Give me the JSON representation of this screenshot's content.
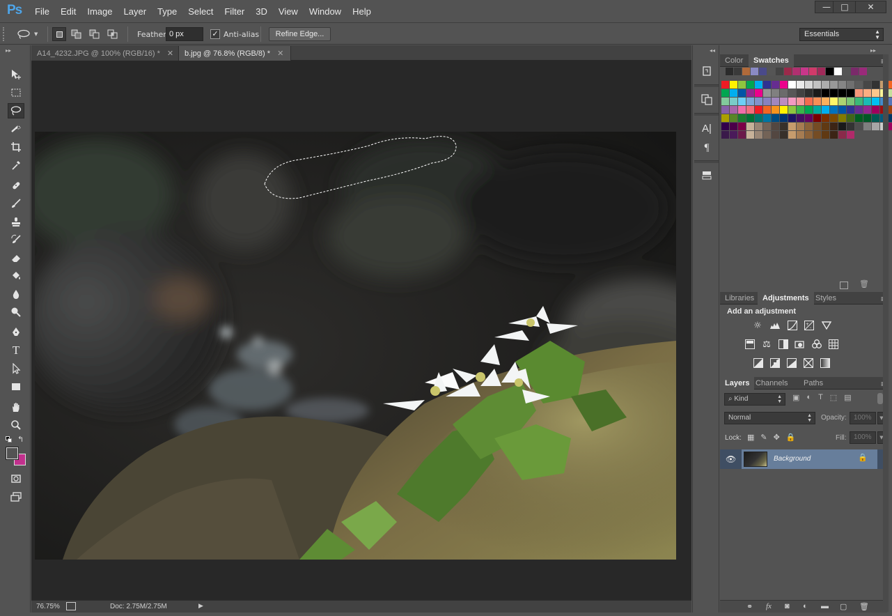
{
  "app": {
    "logo": "Ps"
  },
  "menu": [
    "File",
    "Edit",
    "Image",
    "Layer",
    "Type",
    "Select",
    "Filter",
    "3D",
    "View",
    "Window",
    "Help"
  ],
  "window_controls": {
    "minimize": "—",
    "restore": "□",
    "close": "✕"
  },
  "options_bar": {
    "feather_label": "Feather:",
    "feather_value": "0 px",
    "antialias_label": "Anti-alias",
    "antialias_checked": true,
    "refine_edge_label": "Refine Edge...",
    "workspace": "Essentials"
  },
  "tabs": [
    {
      "label": "A14_4232.JPG @ 100% (RGB/16) *",
      "active": false
    },
    {
      "label": "b.jpg @ 76.8% (RGB/8) *",
      "active": true
    }
  ],
  "status": {
    "zoom": "76.75%",
    "doc": "Doc: 2.75M/2.75M"
  },
  "colors": {
    "foreground": "#535353",
    "background": "#c2308d",
    "accent": "#4ea5e9"
  },
  "panels": {
    "color_group": {
      "tabs": [
        "Color",
        "Swatches"
      ],
      "active": "Swatches"
    },
    "adjust_group": {
      "tabs": [
        "Libraries",
        "Adjustments",
        "Styles"
      ],
      "active": "Adjustments",
      "title": "Add an adjustment"
    },
    "layers_group": {
      "tabs": [
        "Layers",
        "Channels",
        "Paths"
      ],
      "active": "Layers",
      "filter_kind": "Kind",
      "blend_mode": "Normal",
      "opacity_label": "Opacity:",
      "opacity_value": "100%",
      "lock_label": "Lock:",
      "fill_label": "Fill:",
      "fill_value": "100%",
      "layers": [
        {
          "name": "Background",
          "visible": true,
          "locked": true
        }
      ]
    }
  },
  "swatches": [
    [
      "#2b2b2b",
      "#3a3a3a",
      "#b06a3a",
      "#8a8ac4",
      "#4a4a8a",
      "#555",
      "#444",
      "#9a2a4a",
      "#b03070",
      "#c8368a",
      "#d03a6a",
      "#a02a5a",
      "#000",
      "#ffffff",
      "#555",
      "#7a2a6a",
      "#9a2a7a"
    ],
    [
      "#ed1c24",
      "#fff200",
      "#8dc63f",
      "#00a651",
      "#00aeef",
      "#2e3192",
      "#662d91",
      "#ec008c",
      "#fff",
      "#ebebeb",
      "#d7d7d7",
      "#c2c2c2",
      "#adadad",
      "#999",
      "#858585",
      "#707070",
      "#5c5c5c",
      "#474747",
      "#333",
      "#c69c6d",
      "#f26522",
      "#ffff00"
    ],
    [
      "#00a651",
      "#00aeef",
      "#0054a6",
      "#92278f",
      "#ec008c",
      "#959595",
      "#808080",
      "#6b6b6b",
      "#575757",
      "#424242",
      "#2e2e2e",
      "#1a1a1a",
      "#000",
      "#000",
      "#000",
      "#000",
      "#f7977a",
      "#fbad82",
      "#fdc68c",
      "#fff799",
      "#c4df9b",
      "#a3d39c"
    ],
    [
      "#82ca9c",
      "#7accc8",
      "#6dcff6",
      "#7da7d8",
      "#8393ca",
      "#8882be",
      "#a187be",
      "#bc8dbf",
      "#f49ac1",
      "#f5989d",
      "#f26c4f",
      "#f68e56",
      "#fbaf5d",
      "#fff568",
      "#acd372",
      "#7cc576",
      "#3bb878",
      "#1abbb4",
      "#00bff3",
      "#438ccb",
      "#5574b9",
      "#605ca8"
    ],
    [
      "#8560a8",
      "#a864a8",
      "#f06eaa",
      "#f26d7d",
      "#ed1c24",
      "#f26522",
      "#f7941d",
      "#fff200",
      "#8dc63f",
      "#39b54a",
      "#00a651",
      "#00a99d",
      "#00aeef",
      "#0072bc",
      "#0054a6",
      "#2e3192",
      "#662d91",
      "#92278f",
      "#9e005d",
      "#9e0b0f",
      "#a0410d",
      "#a36209"
    ],
    [
      "#aba000",
      "#598527",
      "#1a7b30",
      "#007236",
      "#00746b",
      "#0076a3",
      "#004b80",
      "#003471",
      "#1b1464",
      "#440e62",
      "#630460",
      "#790000",
      "#7b2e00",
      "#7d4900",
      "#827b00",
      "#406618",
      "#005e20",
      "#005826",
      "#005952",
      "#005b7f",
      "#003663",
      "#002157"
    ],
    [
      "#32004b",
      "#4b0049",
      "#7b0046",
      "#c7b299",
      "#998675",
      "#736357",
      "#534741",
      "#37302a",
      "#c69c6d",
      "#a67c52",
      "#8c6239",
      "#754c24",
      "#603913",
      "#3c2415",
      "#1a1a1a",
      "#333",
      "#4d4d4d",
      "#7f7f7f",
      "#a6a6a6",
      "#cccccc",
      "#9e005d",
      "#ff00ff"
    ]
  ],
  "swatches_row7": [
    "#3a1a4a",
    "#4a1a5a",
    "#6a1a4a",
    "#c7b299",
    "#998675",
    "#736357",
    "#534741",
    "#37302a",
    "#c69c6d",
    "#a67c52",
    "#8c6239",
    "#754c24",
    "#603913",
    "#3c2415",
    "#8a2a4a",
    "#b02a6a"
  ]
}
